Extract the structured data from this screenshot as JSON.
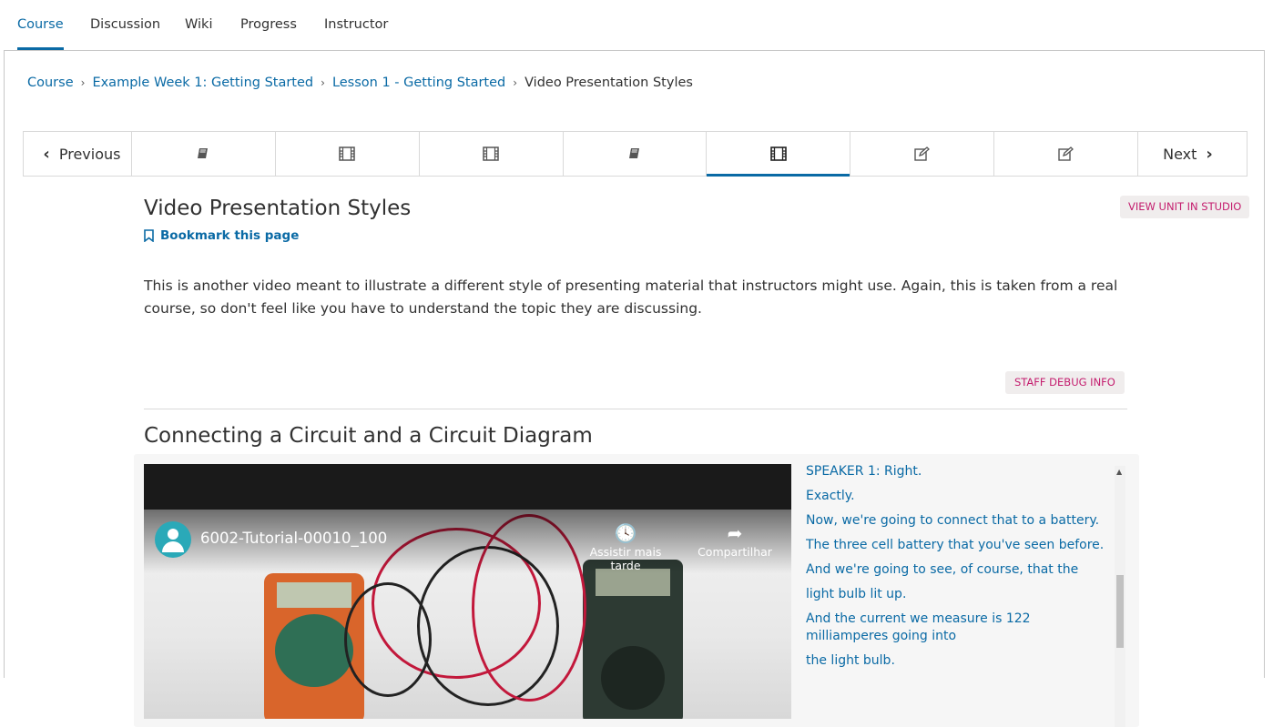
{
  "course_tabs": [
    "Course",
    "Discussion",
    "Wiki",
    "Progress",
    "Instructor"
  ],
  "breadcrumb": {
    "items": [
      "Course",
      "Example Week 1: Getting Started",
      "Lesson 1 - Getting Started"
    ],
    "current": "Video Presentation Styles",
    "separator": "›"
  },
  "sequence_nav": {
    "previous": "Previous",
    "next": "Next",
    "units": [
      "book-icon",
      "film-icon",
      "film-icon",
      "book-icon",
      "film-icon",
      "edit-icon",
      "edit-icon"
    ],
    "active_index": 4
  },
  "unit": {
    "title": "Video Presentation Styles",
    "studio_button": "VIEW UNIT IN STUDIO",
    "bookmark": "Bookmark this page",
    "description": "This is another video meant to illustrate a different style of presenting material that instructors might use. Again, this is taken from a real course, so don't feel like you have to understand the topic they are discussing.",
    "debug_button": "STAFF DEBUG INFO"
  },
  "video": {
    "heading": "Connecting a Circuit and a Circuit Diagram",
    "yt_title": "6002-Tutorial-00010_100",
    "watch_later": "Assistir mais tarde",
    "share": "Compartilhar",
    "transcript": [
      "SPEAKER 1: Right.",
      "Exactly.",
      "Now, we're going to connect that to a battery.",
      "The three cell battery that you've seen before.",
      "And we're going to see, of course, that the",
      "light bulb lit up.",
      "And the current we measure is 122 milliamperes going into",
      "the light bulb."
    ]
  },
  "colors": {
    "link": "#0a6aa5",
    "staff": "#c41d6e",
    "border": "#d9d9d9"
  }
}
